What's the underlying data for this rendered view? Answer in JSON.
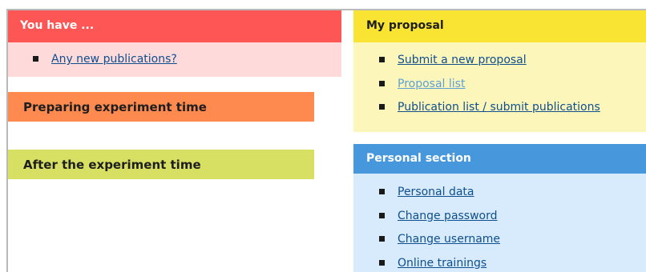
{
  "left": {
    "you_have": {
      "title": "You have ...",
      "links": [
        "Any new publications?"
      ]
    },
    "preparing": {
      "title": "Preparing experiment time"
    },
    "after": {
      "title": "After the experiment time"
    }
  },
  "right": {
    "my_proposal": {
      "title": "My proposal",
      "links": [
        "Submit a new proposal",
        "Proposal list",
        "Publication list / submit publications"
      ]
    },
    "personal": {
      "title": "Personal section",
      "links": [
        "Personal data",
        "Change password",
        "Change username",
        "Online trainings"
      ]
    }
  },
  "colors": {
    "you_have_header": "#fe5555",
    "you_have_body": "#fedada",
    "preparing": "#fe8a4f",
    "after": "#d7e062",
    "my_proposal_header": "#f9e434",
    "my_proposal_body": "#fdf6ba",
    "personal_header": "#4697db",
    "personal_body": "#d7ebfd",
    "link": "#0f4f8e",
    "link_visited": "#5da0d6"
  }
}
